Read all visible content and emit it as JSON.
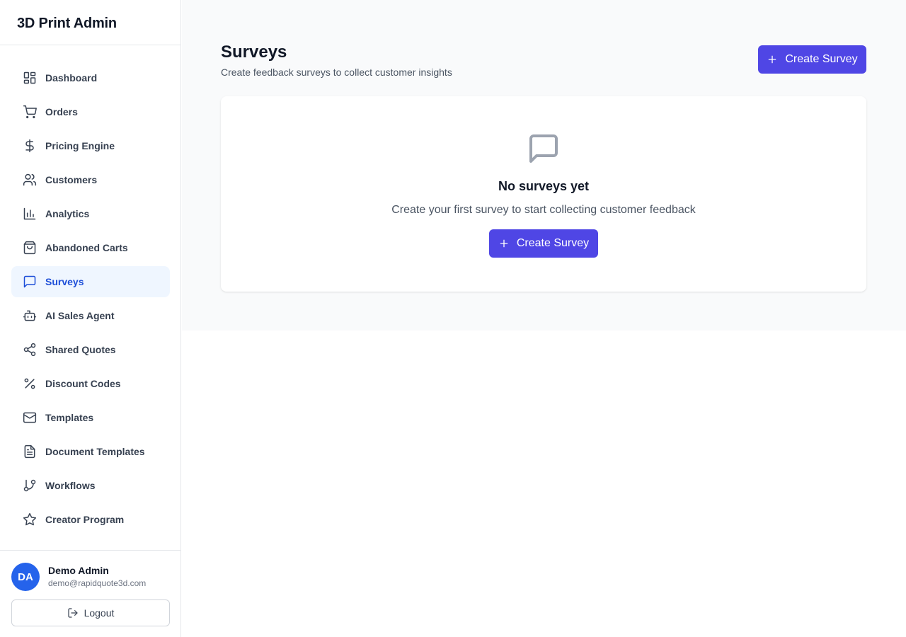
{
  "app": {
    "title": "3D Print Admin"
  },
  "sidebar": {
    "items": [
      {
        "label": "Dashboard",
        "icon": "dashboard-icon"
      },
      {
        "label": "Orders",
        "icon": "cart-icon"
      },
      {
        "label": "Pricing Engine",
        "icon": "dollar-icon"
      },
      {
        "label": "Customers",
        "icon": "users-icon"
      },
      {
        "label": "Analytics",
        "icon": "bar-chart-icon"
      },
      {
        "label": "Abandoned Carts",
        "icon": "shopping-bag-icon"
      },
      {
        "label": "Surveys",
        "icon": "message-square-icon",
        "active": true
      },
      {
        "label": "AI Sales Agent",
        "icon": "bot-icon"
      },
      {
        "label": "Shared Quotes",
        "icon": "share-icon"
      },
      {
        "label": "Discount Codes",
        "icon": "percent-icon"
      },
      {
        "label": "Templates",
        "icon": "mail-icon"
      },
      {
        "label": "Document Templates",
        "icon": "file-text-icon"
      },
      {
        "label": "Workflows",
        "icon": "git-branch-icon"
      },
      {
        "label": "Creator Program",
        "icon": "star-icon"
      }
    ]
  },
  "user": {
    "initials": "DA",
    "name": "Demo Admin",
    "email": "demo@rapidquote3d.com",
    "logout_label": "Logout"
  },
  "main": {
    "title": "Surveys",
    "subtitle": "Create feedback surveys to collect customer insights",
    "create_label": "Create Survey",
    "empty": {
      "title": "No surveys yet",
      "text": "Create your first survey to start collecting customer feedback",
      "button_label": "Create Survey"
    }
  },
  "colors": {
    "accent": "#4f46e5",
    "active_nav_bg": "#eff6ff",
    "active_nav_text": "#1d4ed8",
    "avatar": "#2563eb"
  }
}
